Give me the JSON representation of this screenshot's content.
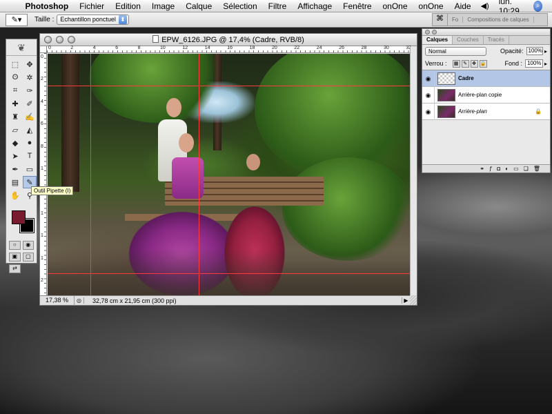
{
  "menubar": {
    "app": "Photoshop",
    "menus": [
      "Fichier",
      "Edition",
      "Image",
      "Calque",
      "Sélection",
      "Filtre",
      "Affichage",
      "Fenêtre",
      "onOne",
      "onOne",
      "Aide"
    ],
    "clock": "lun. 10:29"
  },
  "options": {
    "size_label": "Taille :",
    "size_value": "Echantillon ponctuel",
    "palette_tabs": [
      "Fo",
      "Compositions de calques"
    ]
  },
  "toolbox": {
    "tooltip": "Outil Pipette (I)",
    "foreground_color": "#7a1a2e",
    "background_color": "#000000"
  },
  "document": {
    "title": "EPW_6126.JPG @ 17,4% (Cadre, RVB/8)",
    "zoom": "17,38 %",
    "doc_info": "32,78 cm x 21,95 cm (300 ppi)",
    "ruler_h": [
      "0",
      "2",
      "4",
      "6",
      "8",
      "10",
      "12",
      "14",
      "16",
      "18",
      "20",
      "22",
      "24",
      "26",
      "28",
      "30",
      "32"
    ],
    "ruler_v": [
      "0",
      "2",
      "4",
      "6",
      "8",
      "1",
      "1",
      "1",
      "1",
      "1",
      "2"
    ]
  },
  "layers_panel": {
    "tabs": [
      "Calques",
      "Couches",
      "Tracés"
    ],
    "blend_mode": "Normal",
    "opacity_label": "Opacité:",
    "opacity_value": "100%",
    "lock_label": "Verrou :",
    "fill_label": "Fond :",
    "fill_value": "100%",
    "layers": [
      {
        "name": "Cadre",
        "selected": true
      },
      {
        "name": "Arrière-plan copie",
        "selected": false
      },
      {
        "name": "Arrière-plan",
        "selected": false
      }
    ]
  }
}
